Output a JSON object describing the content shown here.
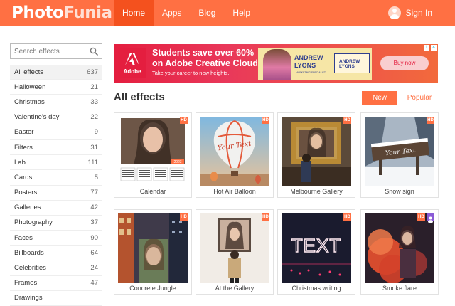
{
  "brand": {
    "part1": "Photo",
    "part2": "Funia"
  },
  "nav": [
    {
      "label": "Home"
    },
    {
      "label": "Apps"
    },
    {
      "label": "Blog"
    },
    {
      "label": "Help"
    }
  ],
  "account": {
    "signin_label": "Sign In"
  },
  "search": {
    "placeholder": "Search effects"
  },
  "categories": [
    {
      "name": "All effects",
      "count": "637"
    },
    {
      "name": "Halloween",
      "count": "21"
    },
    {
      "name": "Christmas",
      "count": "33"
    },
    {
      "name": "Valentine's day",
      "count": "22"
    },
    {
      "name": "Easter",
      "count": "9"
    },
    {
      "name": "Filters",
      "count": "31"
    },
    {
      "name": "Lab",
      "count": "111"
    },
    {
      "name": "Cards",
      "count": "5"
    },
    {
      "name": "Posters",
      "count": "77"
    },
    {
      "name": "Galleries",
      "count": "42"
    },
    {
      "name": "Photography",
      "count": "37"
    },
    {
      "name": "Faces",
      "count": "90"
    },
    {
      "name": "Billboards",
      "count": "64"
    },
    {
      "name": "Celebrities",
      "count": "24"
    },
    {
      "name": "Frames",
      "count": "47"
    },
    {
      "name": "Drawings",
      "count": ""
    }
  ],
  "ad": {
    "brand_label": "Adobe",
    "headline1": "Students save over 60%",
    "headline2": "on Adobe Creative Cloud.",
    "subline": "Take your career to new heights.",
    "person_name1": "ANDREW",
    "person_name2": "LYONS",
    "person_title": "MARKETING SPECIALIST",
    "buy_label": "Buy now"
  },
  "main": {
    "title": "All effects",
    "tab_new": "New",
    "tab_popular": "Popular"
  },
  "effects": [
    {
      "name": "Calendar",
      "hd": "HD"
    },
    {
      "name": "Hot Air Balloon",
      "hd": "HD",
      "art_text": "Your Text"
    },
    {
      "name": "Melbourne Gallery",
      "hd": "HD"
    },
    {
      "name": "Snow sign",
      "hd": "HD",
      "art_text": "Your Text"
    },
    {
      "name": "Concrete Jungle",
      "hd": "HD"
    },
    {
      "name": "At the Gallery",
      "hd": "HD"
    },
    {
      "name": "Christmas writing",
      "hd": "HD",
      "art_text": "TEXT"
    },
    {
      "name": "Smoke flare",
      "hd": "HD"
    }
  ],
  "colors": {
    "accent": "#ff7043",
    "accent_dark": "#f4511e"
  },
  "calendar_year": "2023"
}
